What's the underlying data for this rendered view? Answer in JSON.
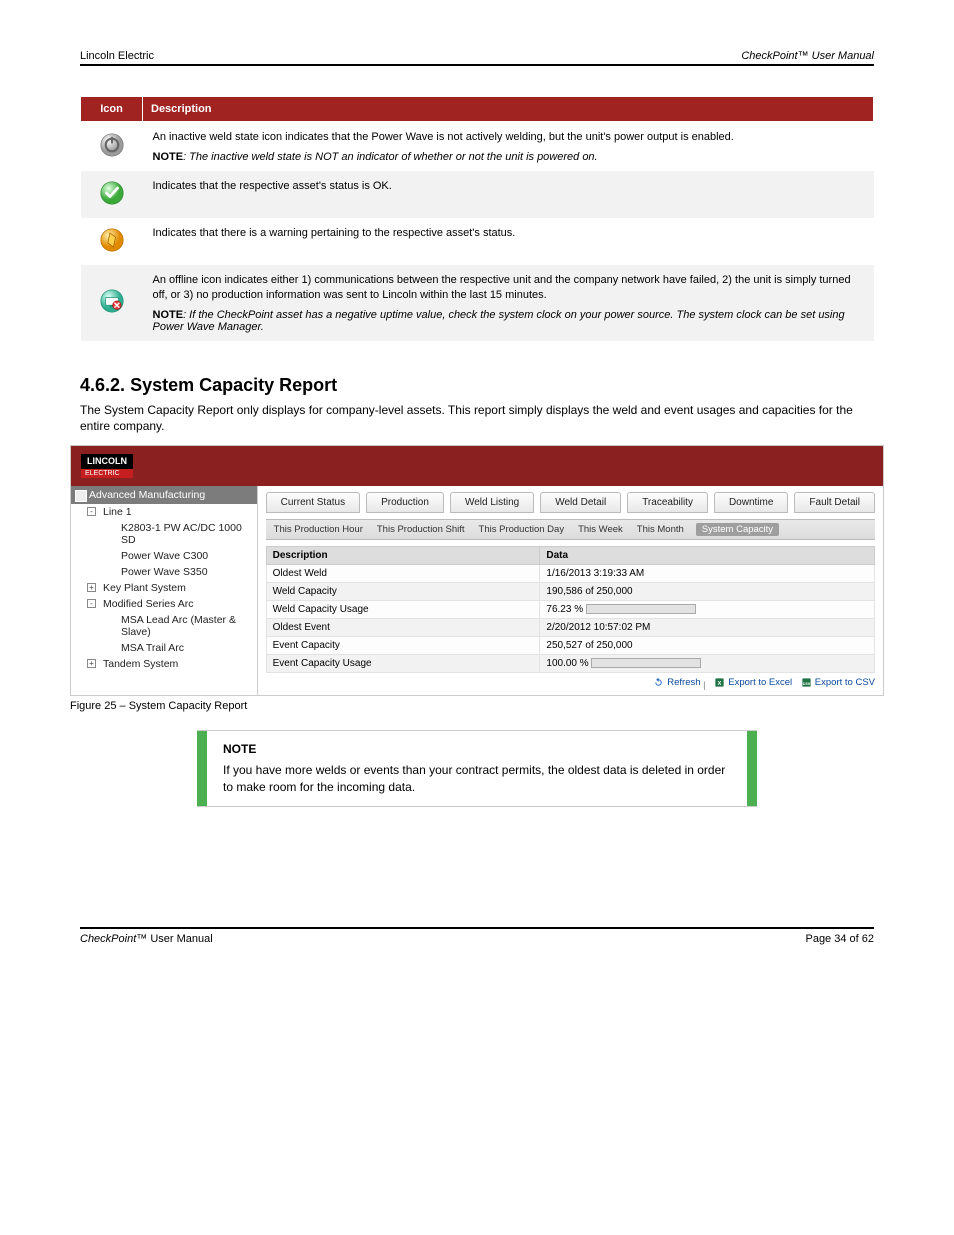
{
  "header": {
    "left": "Lincoln Electric",
    "right_prefix": "CheckPoint™",
    "right_suffix": " User Manual"
  },
  "icon_table": {
    "headers": [
      "Icon",
      "Description"
    ],
    "rows": [
      {
        "shaded": false,
        "icon": "power-idle-icon",
        "desc": "An inactive weld state icon indicates that the Power Wave is not actively welding, but the unit's power output is enabled.",
        "note_label": "NOTE",
        "note": "The inactive weld state is NOT an indicator of whether or not the unit is powered on."
      },
      {
        "shaded": true,
        "icon": "ok-icon",
        "desc": "Indicates that the respective asset's status is OK."
      },
      {
        "shaded": false,
        "icon": "warning-icon",
        "desc": "Indicates that there is a warning pertaining to the respective asset's status."
      },
      {
        "shaded": true,
        "icon": "offline-icon",
        "desc": "An offline icon indicates either 1) communications between the respective unit and the company network have failed, 2) the unit is simply turned off, or 3) no production information was sent to Lincoln within the last 15 minutes.",
        "note_label": "NOTE",
        "note": "If the CheckPoint asset has a negative uptime value, check the system clock on your power source.  The system clock can be set using Power Wave Manager."
      }
    ]
  },
  "section": {
    "number": "4.6.2.",
    "title": "System Capacity Report",
    "para": "The System Capacity Report only displays for company-level assets. This report simply displays the weld and event usages and capacities for the entire company."
  },
  "screenshot": {
    "logo_top": "LINCOLN",
    "logo_bottom": "ELECTRIC",
    "tree_root": "Advanced Manufacturing",
    "tree": [
      {
        "label": "Line 1",
        "toggle": "-",
        "children": [
          {
            "label": "K2803-1 PW AC/DC 1000 SD"
          },
          {
            "label": "Power Wave C300"
          },
          {
            "label": "Power Wave S350"
          }
        ]
      },
      {
        "label": "Key Plant System",
        "toggle": "+"
      },
      {
        "label": "Modified Series Arc",
        "toggle": "-",
        "children": [
          {
            "label": "MSA Lead Arc (Master & Slave)"
          },
          {
            "label": "MSA Trail Arc"
          }
        ]
      },
      {
        "label": "Tandem System",
        "toggle": "+"
      }
    ],
    "tabs": [
      "Current Status",
      "Production",
      "Weld Listing",
      "Weld Detail",
      "Traceability",
      "Downtime",
      "Fault Detail"
    ],
    "subtabs": [
      "This Production Hour",
      "This Production Shift",
      "This Production Day",
      "This Week",
      "This Month",
      "System Capacity"
    ],
    "active_subtab": 5,
    "grid_headers": [
      "Description",
      "Data"
    ],
    "grid_rows": [
      {
        "alt": false,
        "desc": "Oldest Weld",
        "data": "1/16/2013 3:19:33 AM"
      },
      {
        "alt": true,
        "desc": "Weld Capacity",
        "data": "190,586 of 250,000"
      },
      {
        "alt": false,
        "desc": "Weld Capacity Usage",
        "data": "76.23 %",
        "bar": 76
      },
      {
        "alt": true,
        "desc": "Oldest Event",
        "data": "2/20/2012 10:57:02 PM"
      },
      {
        "alt": false,
        "desc": "Event Capacity",
        "data": "250,527 of 250,000"
      },
      {
        "alt": true,
        "desc": "Event Capacity Usage",
        "data": "100.00 %",
        "bar": 100
      }
    ],
    "actions": {
      "refresh": "Refresh",
      "excel": "Export to Excel",
      "csv": "Export to CSV"
    }
  },
  "figure_caption": "Figure 25 – System Capacity Report",
  "ribbon": {
    "title": "NOTE",
    "text": "If you have more welds or events than your contract permits, the oldest data is deleted in order to make room for the incoming data."
  },
  "footer": {
    "left_prefix": "CheckPoint™",
    "left_suffix": " User Manual",
    "right": "Page 34 of 62"
  }
}
